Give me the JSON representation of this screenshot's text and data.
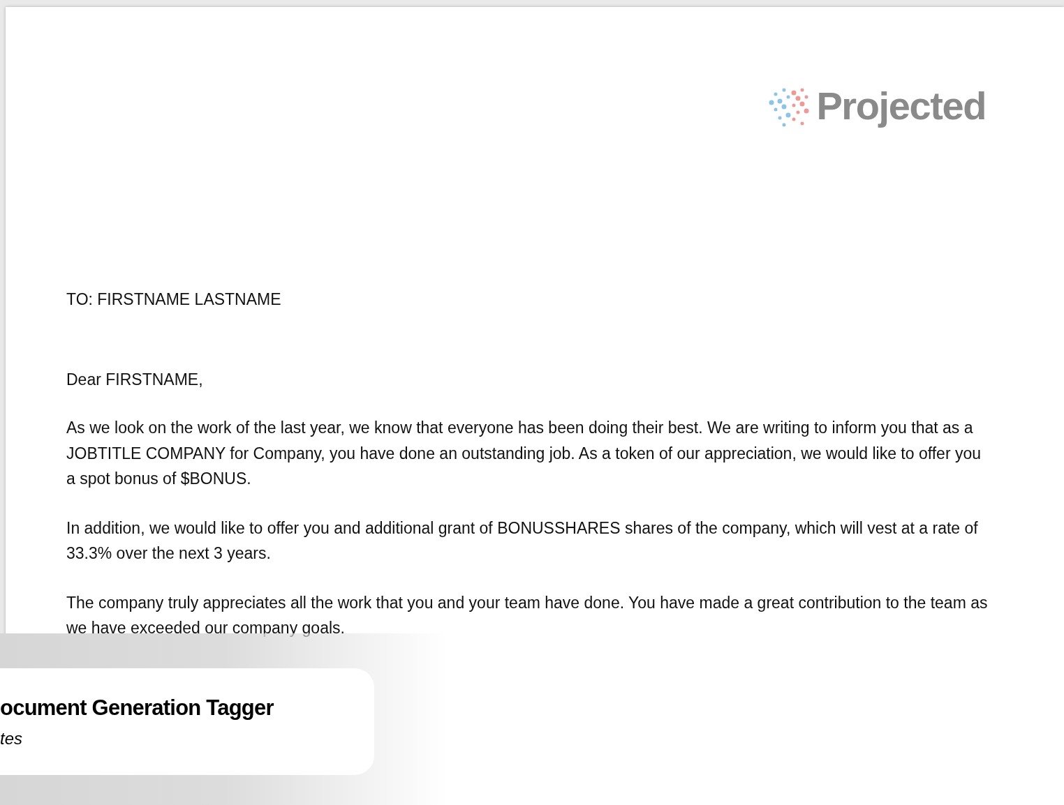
{
  "document": {
    "logo": {
      "text": "Projected"
    },
    "recipient": "TO: FIRSTNAME LASTNAME",
    "greeting": "Dear FIRSTNAME,",
    "paragraphs": [
      "As we look on the work of the last year, we know that everyone has been doing their best. We are writing to inform you that as a JOBTITLE COMPANY for Company, you have done an outstanding job. As a token of our appreciation, we would like to offer you a spot bonus of $BONUS.",
      "In addition, we would like to offer you and additional grant of BONUSSHARES shares of the company, which will vest at a rate of 33.3% over the next 3 years.",
      "The company truly appreciates all the work that you and your team have done. You have made a great contribution to the team as we have exceeded our company goals."
    ]
  },
  "overlay_card": {
    "title": "ocument Generation Tagger",
    "subtitle": "tes"
  }
}
